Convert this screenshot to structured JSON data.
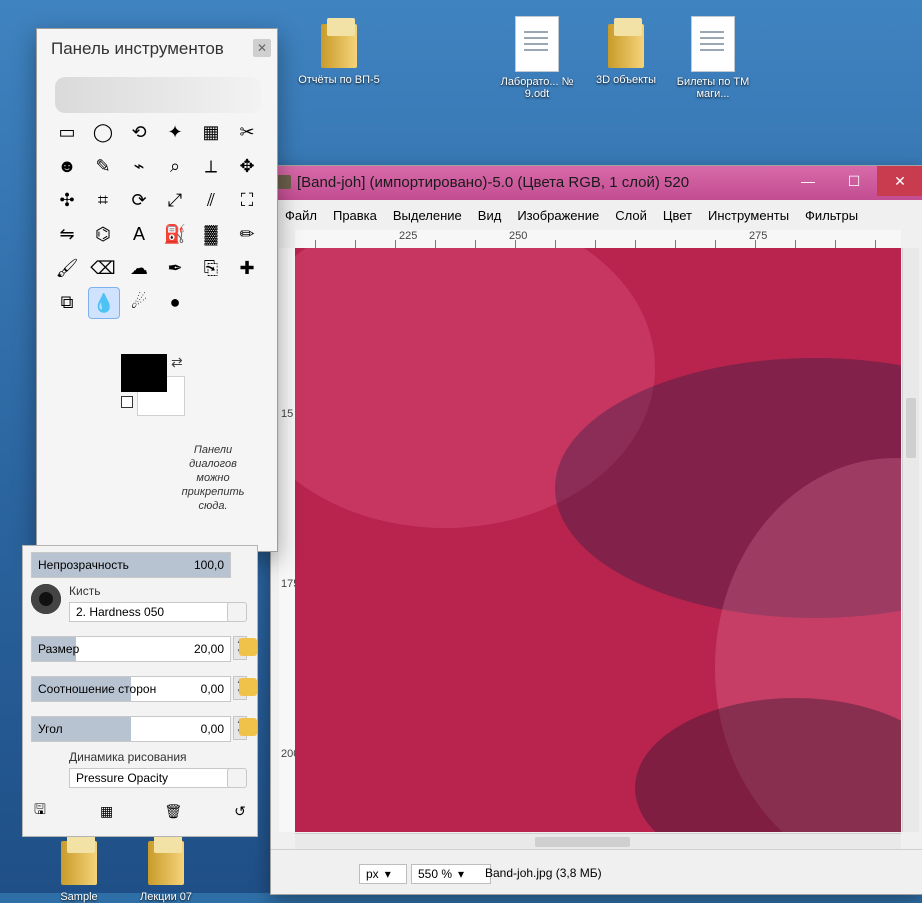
{
  "desktop": {
    "icons": [
      {
        "label": "Отчёты по ВП-5",
        "type": "folder"
      },
      {
        "label": "Лаборато... № 9.odt",
        "type": "doc"
      },
      {
        "label": "3D объекты",
        "type": "folder"
      },
      {
        "label": "Билеты по ТМ маги...",
        "type": "doc"
      },
      {
        "label": "Sample",
        "type": "folder"
      },
      {
        "label": "Лекции 07",
        "type": "folder"
      }
    ]
  },
  "gimp": {
    "title": "[Band-joh] (импортировано)-5.0 (Цвета RGB, 1 слой) 520",
    "menu": [
      "Файл",
      "Правка",
      "Выделение",
      "Вид",
      "Изображение",
      "Слой",
      "Цвет",
      "Инструменты",
      "Фильтры"
    ],
    "ruler": {
      "top_labels": [
        "225",
        "250",
        "275"
      ],
      "left_labels": [
        "15",
        "175",
        "200"
      ]
    },
    "status": {
      "unit": "px",
      "zoom": "550 %",
      "file": "Band-joh.jpg (3,8 МБ)"
    }
  },
  "toolbox": {
    "title": "Панель инструментов",
    "hint_lines": [
      "Панели",
      "диалогов",
      "можно",
      "прикрепить",
      "сюда."
    ],
    "tools": [
      {
        "icon": "rect-select-icon",
        "glyph": "▭"
      },
      {
        "icon": "ellipse-select-icon",
        "glyph": "◯"
      },
      {
        "icon": "lasso-icon",
        "glyph": "⟲"
      },
      {
        "icon": "magic-wand-icon",
        "glyph": "✦"
      },
      {
        "icon": "select-by-color-icon",
        "glyph": "▦"
      },
      {
        "icon": "scissors-icon",
        "glyph": "✂"
      },
      {
        "icon": "foreground-select-icon",
        "glyph": "☻"
      },
      {
        "icon": "paths-icon",
        "glyph": "✎"
      },
      {
        "icon": "color-picker-icon",
        "glyph": "⌁"
      },
      {
        "icon": "zoom-icon",
        "glyph": "⌕"
      },
      {
        "icon": "measure-icon",
        "glyph": "⟂"
      },
      {
        "icon": "move-icon",
        "glyph": "✥"
      },
      {
        "icon": "align-icon",
        "glyph": "✣"
      },
      {
        "icon": "crop-icon",
        "glyph": "⌗"
      },
      {
        "icon": "rotate-icon",
        "glyph": "⟳"
      },
      {
        "icon": "scale-icon",
        "glyph": "⤢"
      },
      {
        "icon": "shear-icon",
        "glyph": "⫽"
      },
      {
        "icon": "perspective-icon",
        "glyph": "⛶"
      },
      {
        "icon": "flip-icon",
        "glyph": "⇋"
      },
      {
        "icon": "cage-icon",
        "glyph": "⌬"
      },
      {
        "icon": "text-icon",
        "glyph": "A"
      },
      {
        "icon": "bucket-fill-icon",
        "glyph": "⛽"
      },
      {
        "icon": "gradient-icon",
        "glyph": "▓"
      },
      {
        "icon": "pencil-icon",
        "glyph": "✏"
      },
      {
        "icon": "paintbrush-icon",
        "glyph": "🖌"
      },
      {
        "icon": "eraser-icon",
        "glyph": "⌫"
      },
      {
        "icon": "airbrush-icon",
        "glyph": "☁"
      },
      {
        "icon": "ink-icon",
        "glyph": "✒"
      },
      {
        "icon": "clone-icon",
        "glyph": "⎘"
      },
      {
        "icon": "heal-icon",
        "glyph": "✚"
      },
      {
        "icon": "perspective-clone-icon",
        "glyph": "⧉"
      },
      {
        "icon": "blur-sharpen-icon",
        "glyph": "💧"
      },
      {
        "icon": "smudge-icon",
        "glyph": "☄"
      },
      {
        "icon": "dodge-burn-icon",
        "glyph": "●"
      }
    ],
    "active_tool_index": 31
  },
  "tool_options": {
    "opacity": {
      "label": "Непрозрачность",
      "value": "100,0",
      "fraction": 1
    },
    "brush": {
      "label": "Кисть",
      "value": "2. Hardness 050"
    },
    "size": {
      "label": "Размер",
      "value": "20,00",
      "fraction": 0.22
    },
    "aspect": {
      "label": "Соотношение сторон",
      "value": "0,00",
      "fraction": 0.5
    },
    "angle": {
      "label": "Угол",
      "value": "0,00",
      "fraction": 0.5
    },
    "dynamics": {
      "label": "Динамика рисования",
      "value": "Pressure Opacity"
    }
  },
  "colors": {
    "gimp_titlebar": "#c24d91",
    "canvas_base": "#b8244e",
    "active_tool_bg": "#cfe3ff"
  }
}
